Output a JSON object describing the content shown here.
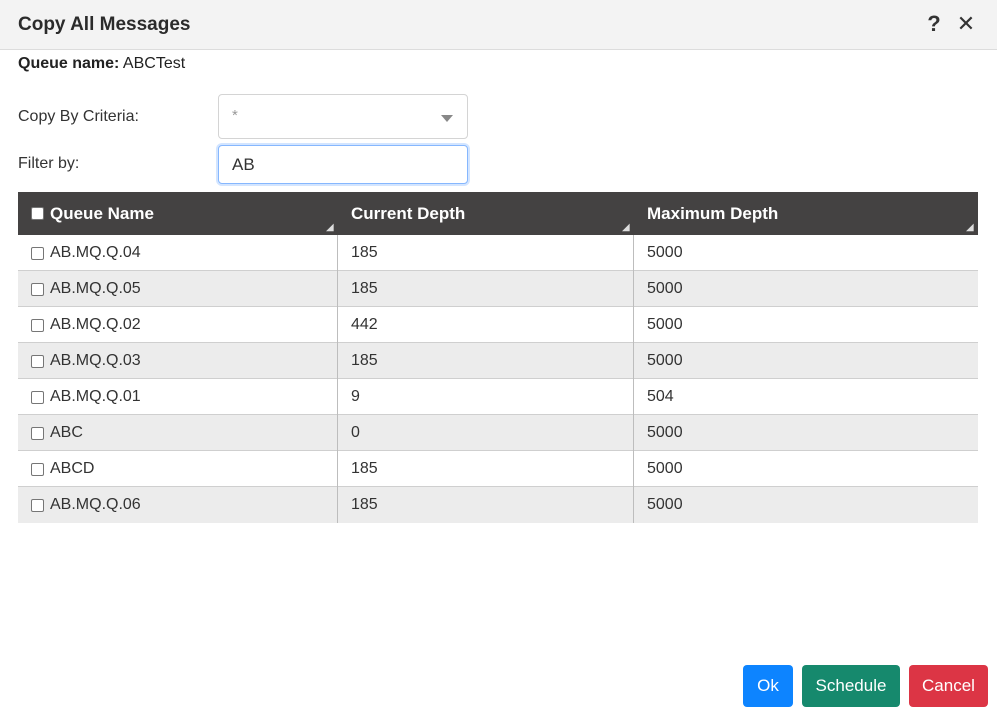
{
  "dialog": {
    "title": "Copy All Messages",
    "help_icon": "?",
    "close_icon": "✕"
  },
  "queue": {
    "label": "Queue name:",
    "value": "ABCTest"
  },
  "form": {
    "criteria_label": "Copy By Criteria:",
    "criteria_value": "*",
    "filter_label": "Filter by:",
    "filter_value": "AB"
  },
  "table": {
    "columns": [
      "Queue Name",
      "Current Depth",
      "Maximum Depth"
    ],
    "rows": [
      {
        "name": "AB.MQ.Q.04",
        "current": "185",
        "max": "5000"
      },
      {
        "name": "AB.MQ.Q.05",
        "current": "185",
        "max": "5000"
      },
      {
        "name": "AB.MQ.Q.02",
        "current": "442",
        "max": "5000"
      },
      {
        "name": "AB.MQ.Q.03",
        "current": "185",
        "max": "5000"
      },
      {
        "name": "AB.MQ.Q.01",
        "current": "9",
        "max": "504"
      },
      {
        "name": "ABC",
        "current": "0",
        "max": "5000"
      },
      {
        "name": "ABCD",
        "current": "185",
        "max": "5000"
      },
      {
        "name": "AB.MQ.Q.06",
        "current": "185",
        "max": "5000"
      }
    ]
  },
  "buttons": {
    "ok": "Ok",
    "schedule": "Schedule",
    "cancel": "Cancel"
  },
  "colors": {
    "header_bg": "#444242",
    "ok": "#0d84ff",
    "schedule": "#16896d",
    "cancel": "#dc3545"
  }
}
